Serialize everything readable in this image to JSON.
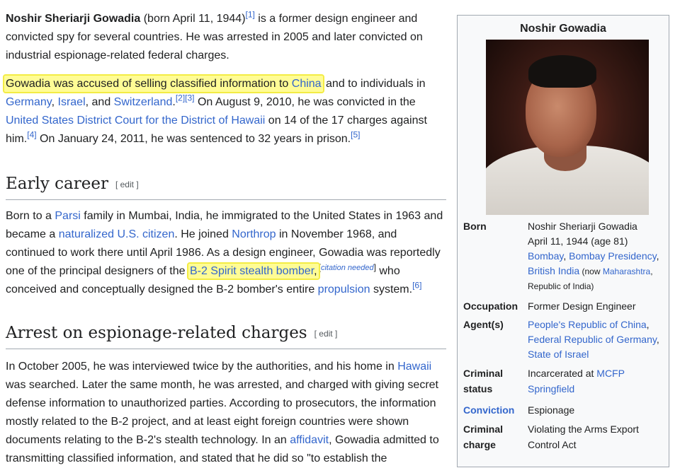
{
  "article": {
    "intro": {
      "name": "Noshir Sheriarji Gowadia",
      "text1": " (born April 11, 1944)",
      "ref1": "[1]",
      "text2": " is a former design engineer and convicted spy for several countries. He was arrested in 2005 and later convicted on industrial espionage-related federal charges."
    },
    "p2": {
      "highlight_text": "Gowadia was accused of selling classified information to ",
      "link_china": "China",
      "text1": " and to individuals in ",
      "link_germany": "Germany",
      "sep1": ", ",
      "link_israel": "Israel",
      "text2": ", and ",
      "link_switzerland": "Switzerland",
      "text3": ".",
      "ref23": "[2][3]",
      "text4": " On August 9, 2010, he was convicted in the ",
      "link_court": "United States District Court for the District of Hawaii",
      "text5": " on 14 of the 17 charges against him.",
      "ref4": "[4]",
      "text6": " On January 24, 2011, he was sentenced to 32 years in prison.",
      "ref5": "[5]"
    },
    "section_early": {
      "heading": "Early career",
      "edit": "[ edit ]",
      "t1": "Born to a ",
      "link_parsi": "Parsi",
      "t2": " family in Mumbai, India, he immigrated to the United States in 1963 and became a ",
      "link_naturalized": "naturalized U.S. citizen",
      "t3": ". He joined ",
      "link_northrop": "Northrop",
      "t4": " in November 1968, and continued to work there until April 1986. As a design engineer, Gowadia was reportedly one of the principal designers of the ",
      "link_b2": "B-2 Spirit stealth bomber",
      "t5": ",",
      "citation_open": "[",
      "citation_needed": "citation needed",
      "citation_close": "]",
      "t6": " who conceived and conceptually designed the B-2 bomber's entire ",
      "link_propulsion": "propulsion",
      "t7": " system.",
      "ref6": "[6]"
    },
    "section_arrest": {
      "heading": "Arrest on espionage-related charges",
      "edit": "[ edit ]",
      "t1": "In October 2005, he was interviewed twice by the authorities, and his home in ",
      "link_hawaii": "Hawaii",
      "t2": " was searched. Later the same month, he was arrested, and charged with giving secret defense information to unauthorized parties. According to prosecutors, the information mostly related to the B-2 project, and at least eight foreign countries were shown documents relating to the B-2's stealth technology. In an ",
      "link_affidavit": "affidavit",
      "t3": ", Gowadia admitted to transmitting classified information, and stated that he did so \"to establish the"
    }
  },
  "infobox": {
    "title": "Noshir Gowadia",
    "born_label": "Born",
    "born_name": "Noshir Sheriarji Gowadia",
    "born_date": "April 11, 1944 (age 81)",
    "born_link1": "Bombay",
    "born_sep1": ", ",
    "born_link2": "Bombay Presidency",
    "born_sep2": ",",
    "born_link3": "British India",
    "born_now_open": " (now ",
    "born_link4": "Maharashtra",
    "born_comma": ",",
    "born_now_rest": "Republic of India)",
    "occupation_label": "Occupation",
    "occupation_value": "Former Design Engineer",
    "agents_label": "Agent(s)",
    "agent1": "People's Republic of China",
    "agent1_sep": ",",
    "agent2": "Federal Republic of Germany",
    "agent2_sep": ",",
    "agent3": "State of Israel",
    "criminal_status_label1": "Criminal",
    "criminal_status_label2": "status",
    "status_text": "Incarcerated at ",
    "status_link1": "MCFP",
    "status_link2": "Springfield",
    "conviction_label": "Conviction",
    "conviction_value": "Espionage",
    "charge_label1": "Criminal",
    "charge_label2": "charge",
    "charge_line1": "Violating the Arms Export",
    "charge_line2": "Control Act"
  },
  "colors": {
    "link": "#3366cc",
    "highlight_fill": "#fffc95",
    "highlight_border": "#f3ec44",
    "infobox_bg": "#f8f9fa"
  }
}
